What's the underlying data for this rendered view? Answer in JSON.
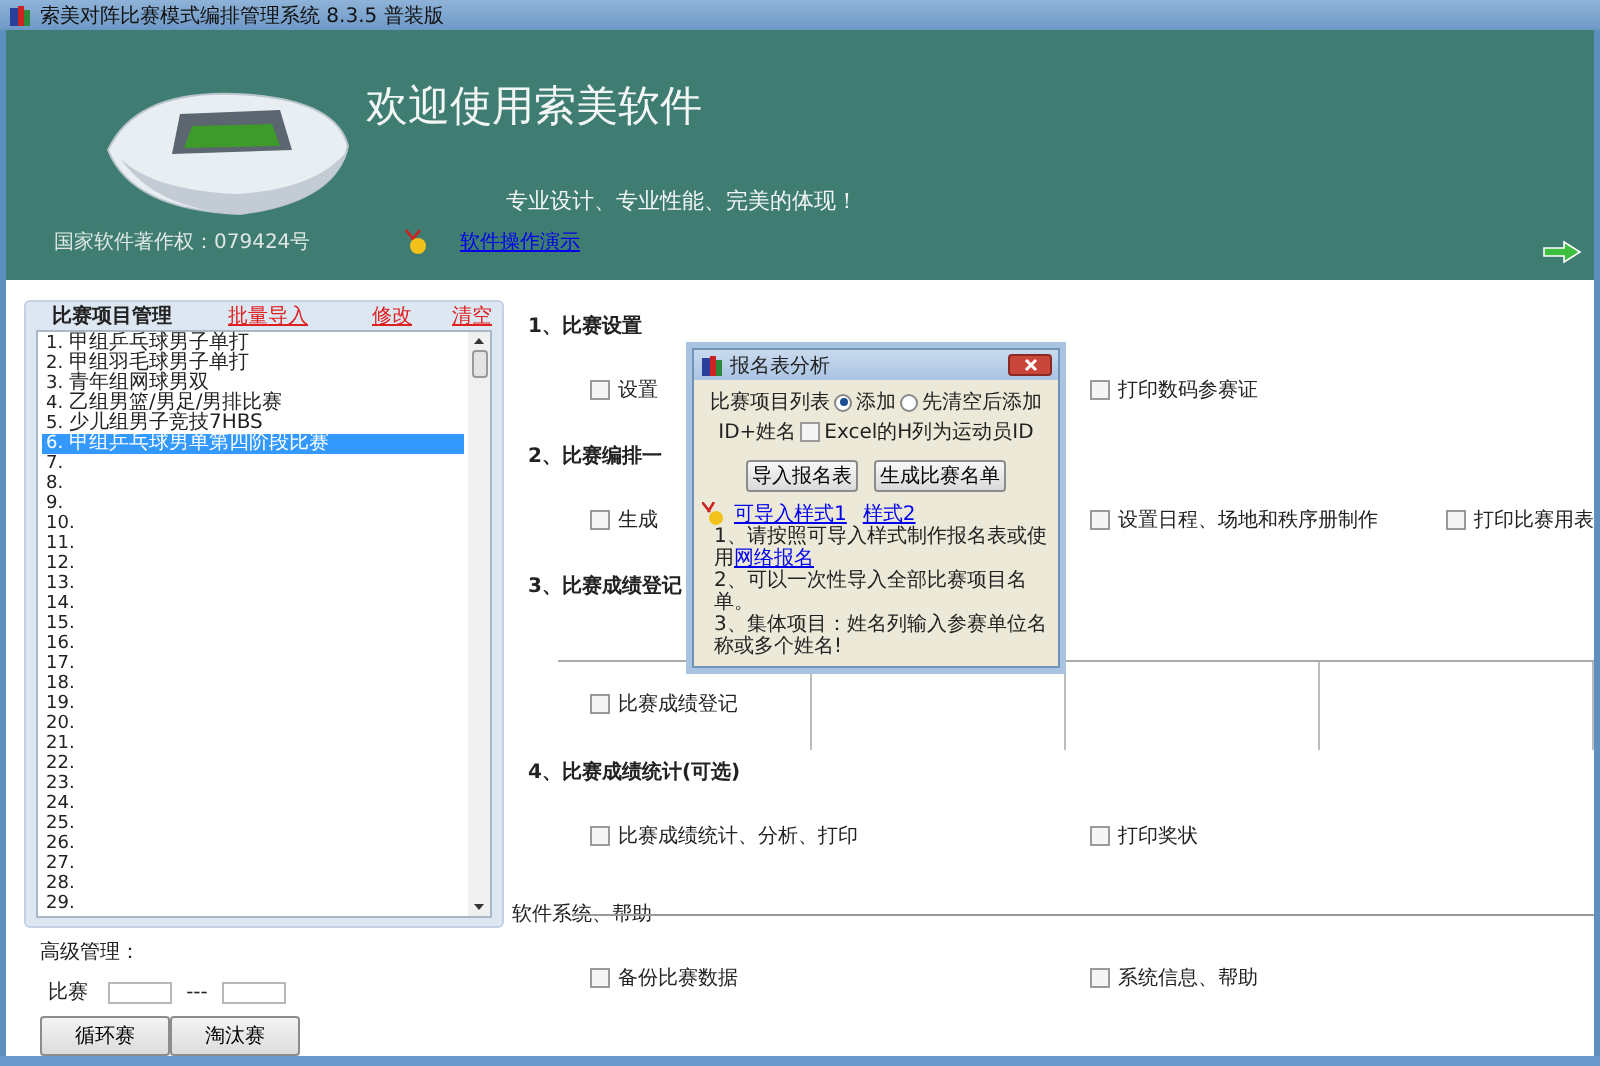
{
  "window": {
    "title": "索美对阵比赛模式编排管理系统  8.3.5  普装版"
  },
  "banner": {
    "headline": "欢迎使用索美软件",
    "slogan": "专业设计、专业性能、完美的体现！",
    "copyright": "国家软件著作权：079424号",
    "demo_link": "软件操作演示"
  },
  "project_panel": {
    "title": "比赛项目管理",
    "actions": [
      "批量导入",
      "修改",
      "清空"
    ],
    "items": [
      {
        "number": "1.",
        "name": "甲组乒乓球男子单打",
        "selected": false
      },
      {
        "number": "2.",
        "name": "甲组羽毛球男子单打",
        "selected": false
      },
      {
        "number": "3.",
        "name": "青年组网球男双",
        "selected": false
      },
      {
        "number": "4.",
        "name": "乙组男篮/男足/男排比赛",
        "selected": false
      },
      {
        "number": "5.",
        "name": "少儿组男子竞技7HBS",
        "selected": false
      },
      {
        "number": "6.",
        "name": "甲组乒乓球男单第四阶段比赛",
        "selected": true
      },
      {
        "number": "7.",
        "selected": false
      },
      {
        "number": "8.",
        "selected": false
      },
      {
        "number": "9.",
        "selected": false
      },
      {
        "number": "10.",
        "selected": false
      },
      {
        "number": "11.",
        "selected": false
      },
      {
        "number": "12.",
        "selected": false
      },
      {
        "number": "13.",
        "selected": false
      },
      {
        "number": "14.",
        "selected": false
      },
      {
        "number": "15.",
        "selected": false
      },
      {
        "number": "16.",
        "selected": false
      },
      {
        "number": "17.",
        "selected": false
      },
      {
        "number": "18.",
        "selected": false
      },
      {
        "number": "19.",
        "selected": false
      },
      {
        "number": "20.",
        "selected": false
      },
      {
        "number": "21.",
        "selected": false
      },
      {
        "number": "22.",
        "selected": false
      },
      {
        "number": "23.",
        "selected": false
      },
      {
        "number": "24.",
        "selected": false
      },
      {
        "number": "25.",
        "selected": false
      },
      {
        "number": "26.",
        "selected": false
      },
      {
        "number": "27.",
        "selected": false
      },
      {
        "number": "28.",
        "selected": false
      },
      {
        "number": "29.",
        "selected": false
      }
    ]
  },
  "advanced": {
    "label": "高级管理：",
    "range_label": "比赛",
    "separator": "---",
    "buttons": [
      "循环赛",
      "淘汰赛"
    ]
  },
  "sections": [
    {
      "kind": "plain",
      "title": "1、比赛设置",
      "options": [
        {
          "label": "设置",
          "checked": false
        },
        {
          "label": "打印数码参赛证",
          "checked": false
        }
      ]
    },
    {
      "kind": "plain",
      "title": "2、比赛编排一",
      "options": [
        {
          "label": "生成",
          "checked": false
        },
        {
          "label": "设置日程、场地和秩序册制作",
          "checked": false
        },
        {
          "label": "打印比赛用表",
          "checked": false
        }
      ]
    },
    {
      "kind": "grid",
      "title": "3、比赛成绩登记",
      "options": [
        {
          "label": "比赛成绩登记",
          "checked": false
        }
      ]
    },
    {
      "kind": "plain",
      "title": "4、比赛成绩统计(可选)",
      "options": [
        {
          "label": "比赛成绩统计、分析、打印",
          "checked": false
        },
        {
          "label": "打印奖状",
          "checked": false
        }
      ]
    },
    {
      "kind": "ruled",
      "title": "软件系统、帮助",
      "options": [
        {
          "label": "备份比赛数据",
          "checked": false
        },
        {
          "label": "系统信息、帮助",
          "checked": false
        }
      ]
    }
  ],
  "dialog": {
    "title": "报名表分析",
    "list_label": "比赛项目列表",
    "modes": [
      {
        "label": "添加",
        "selected": true
      },
      {
        "label": "先清空后添加",
        "selected": false
      }
    ],
    "id_label": "ID+姓名",
    "id_option": {
      "label": "Excel的H列为运动员ID",
      "checked": false
    },
    "buttons": [
      "导入报名表",
      "生成比赛名单"
    ],
    "style_links": [
      "可导入样式1",
      "样式2"
    ],
    "note_1": "1、请按照可导入样式制作报名表或使用",
    "note_1_link": "网络报名",
    "note_2": "2、可以一次性导入全部比赛项目名单。",
    "note_3": "3、集体项目：姓名列输入参赛单位名称或多个姓名!"
  }
}
